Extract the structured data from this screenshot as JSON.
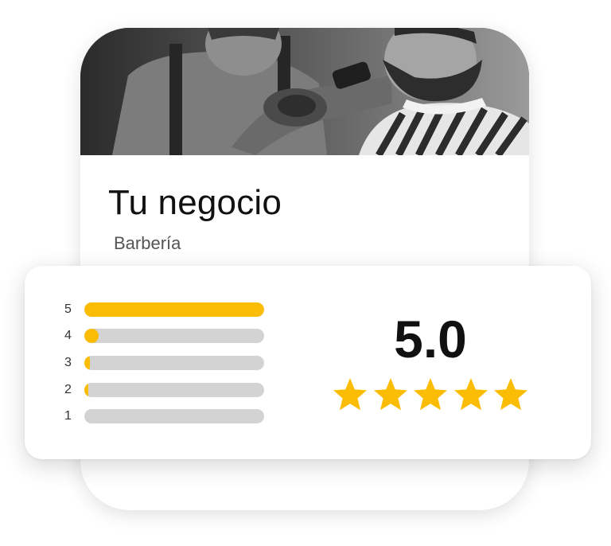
{
  "business": {
    "name": "Tu negocio",
    "category": "Barbería"
  },
  "rating": {
    "average": "5.0",
    "star_count": 5,
    "histogram": [
      {
        "label": "5",
        "fraction": 1.0
      },
      {
        "label": "4",
        "fraction": 0.08
      },
      {
        "label": "3",
        "fraction": 0.03
      },
      {
        "label": "2",
        "fraction": 0.02
      },
      {
        "label": "1",
        "fraction": 0.0
      }
    ]
  },
  "icons": {
    "star": "star-icon",
    "cover": "barber-photo"
  },
  "colors": {
    "accent": "#fbbc04",
    "track": "#d3d3d3",
    "text": "#111111",
    "subtext": "#555555"
  }
}
